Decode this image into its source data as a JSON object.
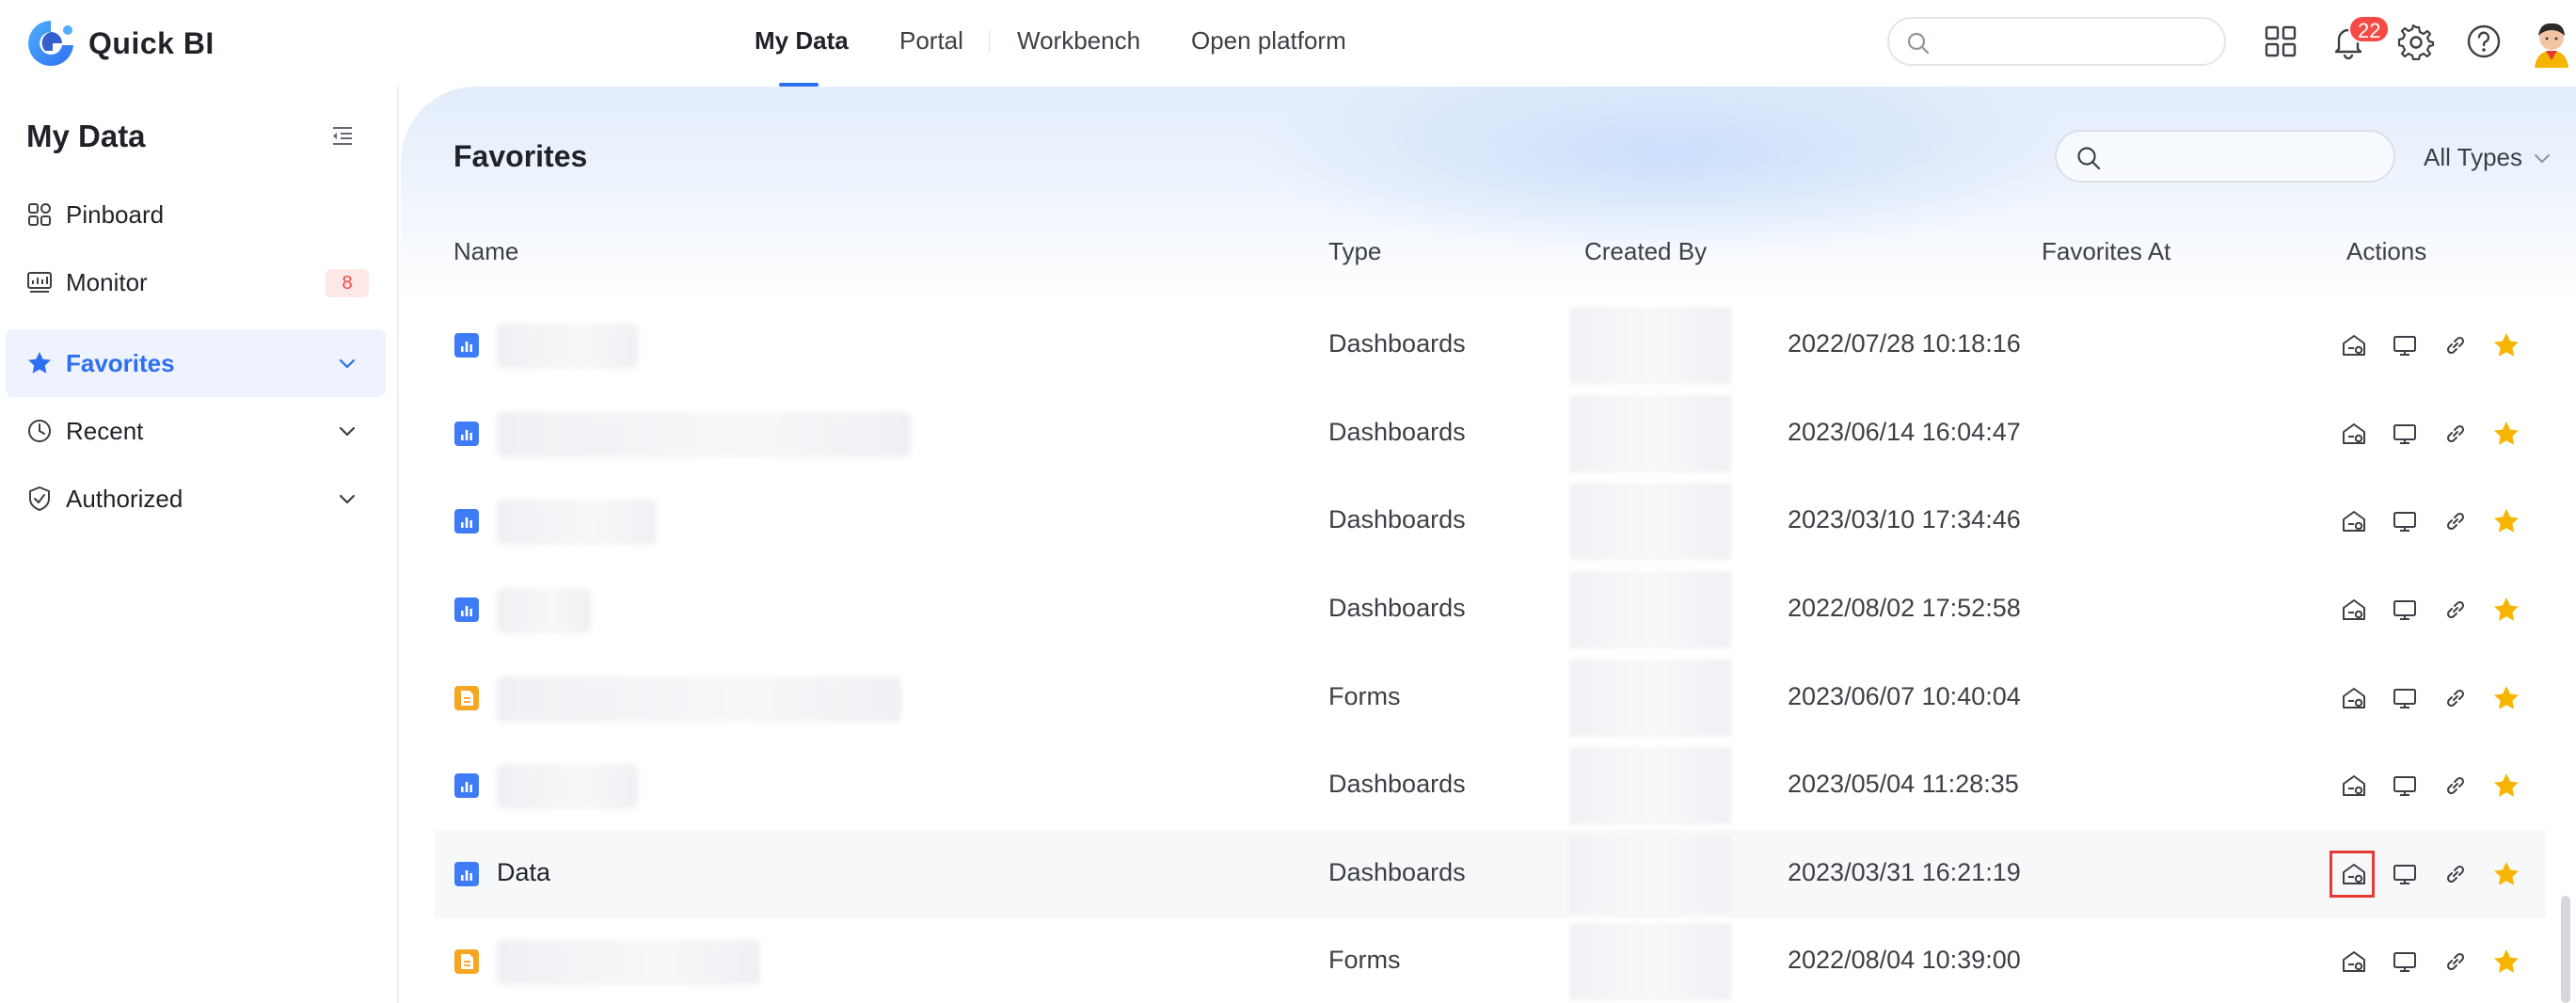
{
  "app": {
    "name": "Quick BI"
  },
  "nav": {
    "tabs": [
      {
        "label": "My Data",
        "active": true
      },
      {
        "label": "Portal"
      },
      {
        "label": "Workbench"
      },
      {
        "label": "Open platform"
      }
    ]
  },
  "header": {
    "search_placeholder": "",
    "notification_count": "22",
    "icons": [
      "search-icon",
      "app-grid-icon",
      "bell-icon",
      "gear-icon",
      "help-icon",
      "avatar"
    ]
  },
  "sidebar": {
    "title": "My Data",
    "items": [
      {
        "label": "Pinboard",
        "icon": "pinboard-icon"
      },
      {
        "label": "Monitor",
        "icon": "monitor-icon",
        "badge": "8"
      },
      {
        "label": "Favorites",
        "icon": "star-icon",
        "active": true,
        "expandable": true
      },
      {
        "label": "Recent",
        "icon": "clock-icon",
        "expandable": true
      },
      {
        "label": "Authorized",
        "icon": "shield-icon",
        "expandable": true
      }
    ]
  },
  "main": {
    "title": "Favorites",
    "search_placeholder": "",
    "type_filter": "All Types",
    "columns": [
      "Name",
      "Type",
      "Created By",
      "Favorites At",
      "Actions"
    ],
    "rows": [
      {
        "name": "",
        "type": "Dashboards",
        "favorited_at": "2022/07/28 10:18:16",
        "kind": "dashboard"
      },
      {
        "name": "",
        "type": "Dashboards",
        "favorited_at": "2023/06/14 16:04:47",
        "kind": "dashboard"
      },
      {
        "name": "",
        "type": "Dashboards",
        "favorited_at": "2023/03/10 17:34:46",
        "kind": "dashboard"
      },
      {
        "name": "",
        "type": "Dashboards",
        "favorited_at": "2022/08/02 17:52:58",
        "kind": "dashboard"
      },
      {
        "name": "",
        "type": "Forms",
        "favorited_at": "2023/06/07 10:40:04",
        "kind": "form"
      },
      {
        "name": "",
        "type": "Dashboards",
        "favorited_at": "2023/05/04 11:28:35",
        "kind": "dashboard"
      },
      {
        "name": "Data",
        "type": "Dashboards",
        "favorited_at": "2023/03/31 16:21:19",
        "kind": "dashboard",
        "highlighted": true
      },
      {
        "name": "",
        "type": "Forms",
        "favorited_at": "2022/08/04 10:39:00",
        "kind": "form"
      }
    ],
    "row_actions": [
      "portal-add-icon",
      "present-icon",
      "link-icon",
      "star-filled-icon"
    ]
  },
  "colors": {
    "accent": "#2e6ff2",
    "badge_red": "#f54a45",
    "star": "#f7b500",
    "dashboard_icon": "#3d7bf7",
    "form_icon": "#f5a623",
    "highlight_border": "#e53b35"
  }
}
